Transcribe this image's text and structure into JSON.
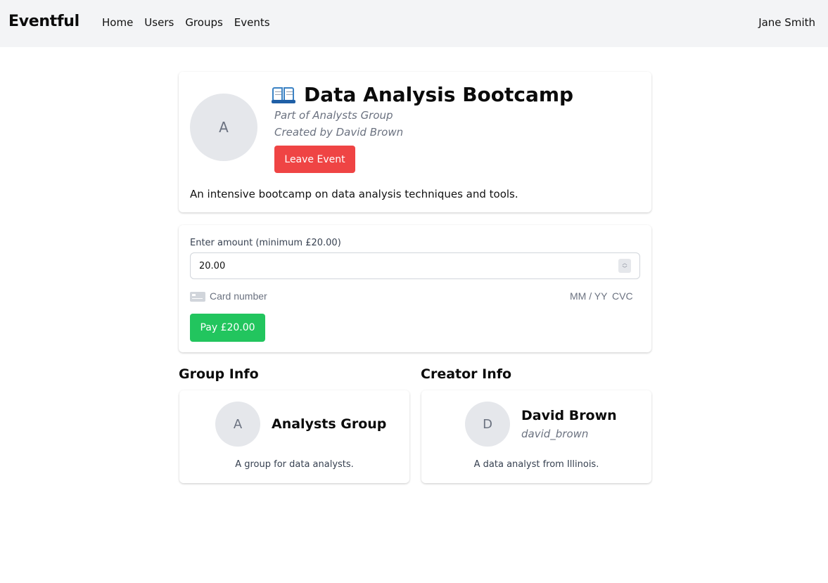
{
  "header": {
    "brand": "Eventful",
    "nav": [
      {
        "label": "Home"
      },
      {
        "label": "Users"
      },
      {
        "label": "Groups"
      },
      {
        "label": "Events"
      }
    ],
    "user_name": "Jane Smith"
  },
  "event": {
    "avatar_initial": "A",
    "icon": "open-book-icon",
    "title": "Data Analysis Bootcamp",
    "group_line": "Part of Analysts Group",
    "creator_line": "Created by David Brown",
    "leave_label": "Leave Event",
    "leave_color": "#ef4444",
    "description": "An intensive bootcamp on data analysis techniques and tools."
  },
  "payment": {
    "amount_label": "Enter amount (minimum £20.00)",
    "amount_value": "20.00",
    "card_placeholder": "Card number",
    "expiry_placeholder": "MM / YY",
    "cvc_placeholder": "CVC",
    "pay_label": "Pay £20.00",
    "pay_color": "#22c55e"
  },
  "group_info": {
    "section_title": "Group Info",
    "avatar_initial": "A",
    "name": "Analysts Group",
    "description": "A group for data analysts."
  },
  "creator_info": {
    "section_title": "Creator Info",
    "avatar_initial": "D",
    "name": "David Brown",
    "username": "david_brown",
    "description": "A data analyst from Illinois."
  }
}
